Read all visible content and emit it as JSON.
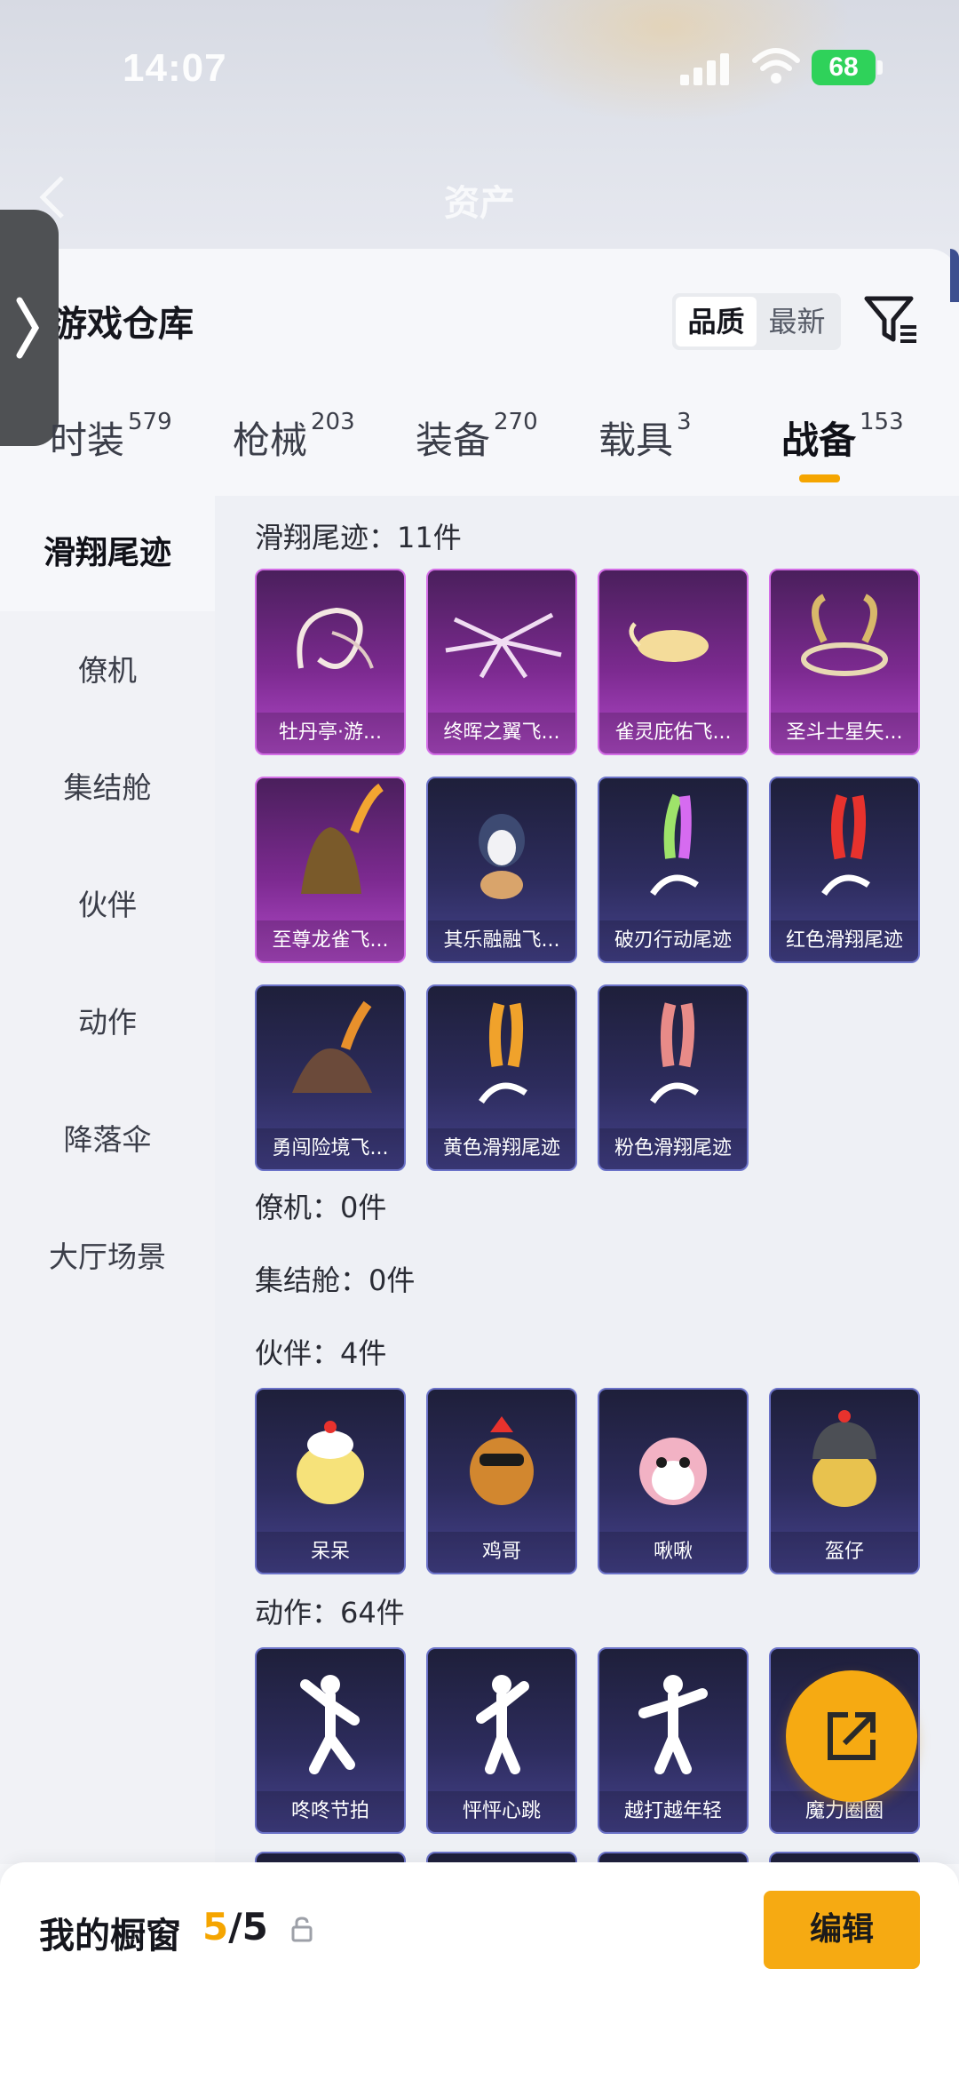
{
  "status_bar": {
    "time": "14:07",
    "battery": "68"
  },
  "nav": {
    "title": "资产"
  },
  "panel": {
    "title": "游戏仓库"
  },
  "sort": {
    "quality": "品质",
    "newest": "最新"
  },
  "tabs": [
    {
      "label": "时装",
      "count": "579"
    },
    {
      "label": "枪械",
      "count": "203"
    },
    {
      "label": "装备",
      "count": "270"
    },
    {
      "label": "载具",
      "count": "3"
    },
    {
      "label": "战备",
      "count": "153"
    }
  ],
  "sidebar": [
    "滑翔尾迹",
    "僚机",
    "集结舱",
    "伙伴",
    "动作",
    "降落伞",
    "大厅场景"
  ],
  "sections": {
    "trails": {
      "title": "滑翔尾迹：11件",
      "items": [
        "牡丹亭·游...",
        "终晖之翼飞...",
        "雀灵庇佑飞...",
        "圣斗士星矢...",
        "至尊龙雀飞...",
        "其乐融融飞...",
        "破刃行动尾迹",
        "红色滑翔尾迹",
        "勇闯险境飞...",
        "黄色滑翔尾迹",
        "粉色滑翔尾迹"
      ]
    },
    "wingman": {
      "title": "僚机：0件"
    },
    "capsule": {
      "title": "集结舱：0件"
    },
    "partners": {
      "title": "伙伴：4件",
      "items": [
        "呆呆",
        "鸡哥",
        "啾啾",
        "盔仔"
      ]
    },
    "emotes": {
      "title": "动作：64件",
      "items": [
        "咚咚节拍",
        "怦怦心跳",
        "越打越年轻",
        "魔力圈圈"
      ]
    }
  },
  "bottom": {
    "label": "我的橱窗",
    "current": "5",
    "total": "/5",
    "edit": "编辑"
  }
}
